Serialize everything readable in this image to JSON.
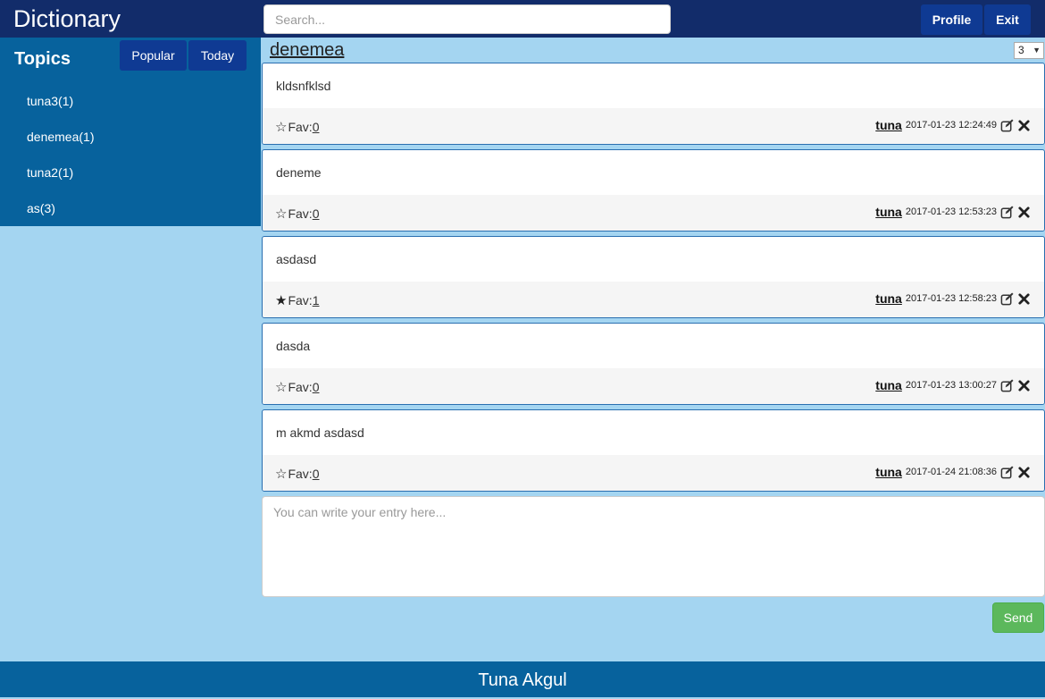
{
  "header": {
    "brand": "Dictionary",
    "search_placeholder": "Search...",
    "profile_label": "Profile",
    "exit_label": "Exit"
  },
  "sidebar": {
    "title": "Topics",
    "popular_label": "Popular",
    "today_label": "Today",
    "topics": [
      {
        "label": "tuna3(1)"
      },
      {
        "label": "denemea(1)"
      },
      {
        "label": "tuna2(1)"
      },
      {
        "label": "as(3)"
      }
    ]
  },
  "topic": {
    "title": "denemea",
    "page_selected": "3"
  },
  "entries": [
    {
      "text": "kldsnfklsd",
      "fav_label": "Fav:",
      "fav_count": "0",
      "favorited": false,
      "author": "tuna",
      "date": "2017-01-23 12:24:49"
    },
    {
      "text": "deneme",
      "fav_label": "Fav:",
      "fav_count": "0",
      "favorited": false,
      "author": "tuna",
      "date": "2017-01-23 12:53:23"
    },
    {
      "text": "asdasd",
      "fav_label": "Fav:",
      "fav_count": "1",
      "favorited": true,
      "author": "tuna",
      "date": "2017-01-23 12:58:23"
    },
    {
      "text": "dasda",
      "fav_label": "Fav:",
      "fav_count": "0",
      "favorited": false,
      "author": "tuna",
      "date": "2017-01-23 13:00:27"
    },
    {
      "text": "m akmd asdasd",
      "fav_label": "Fav:",
      "fav_count": "0",
      "favorited": false,
      "author": "tuna",
      "date": "2017-01-24 21:08:36"
    }
  ],
  "composer": {
    "placeholder": "You can write your entry here...",
    "send_label": "Send"
  },
  "footer": {
    "text": "Tuna Akgul"
  },
  "colors": {
    "topbar": "#122c6a",
    "sidebar": "#07629d",
    "background": "#a4d5f1",
    "button": "#0f3a93",
    "send": "#5cb85c"
  }
}
